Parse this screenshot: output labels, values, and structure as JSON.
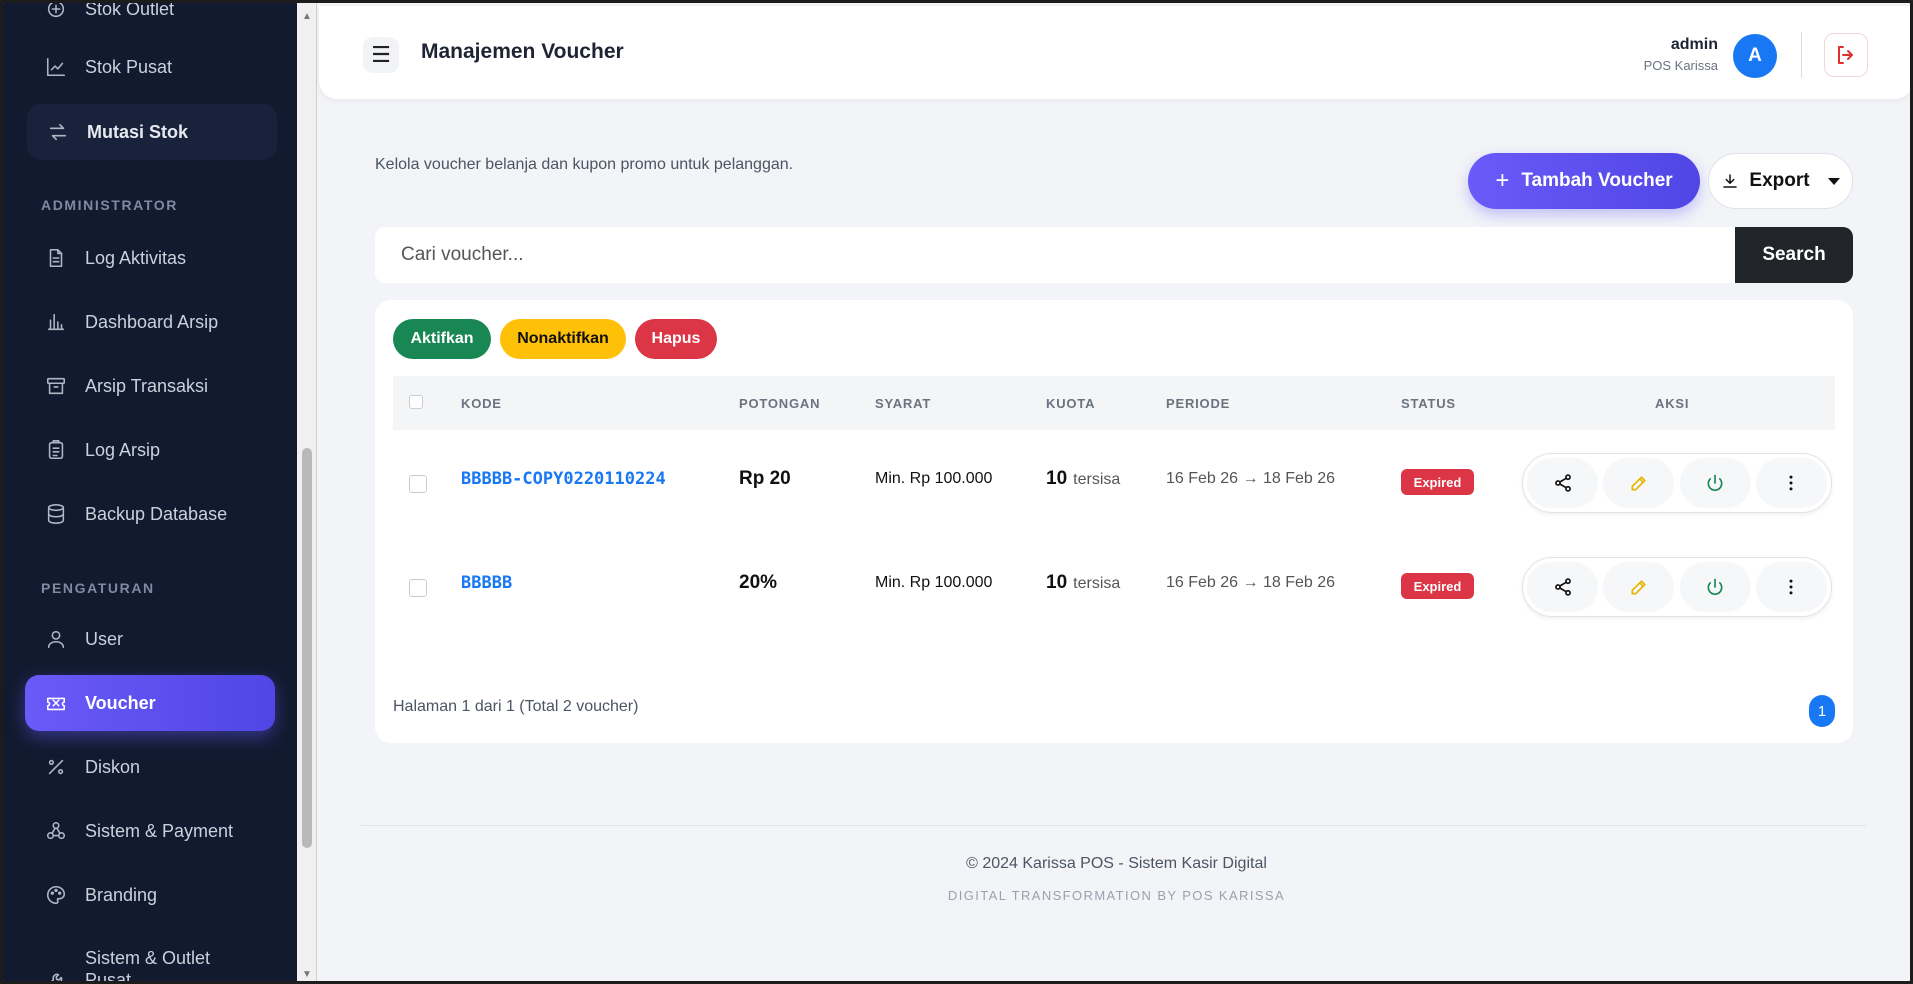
{
  "sidebar": {
    "items_top": [
      {
        "label": "Stok Outlet",
        "icon": "store-icon"
      },
      {
        "label": "Stok Pusat",
        "icon": "chart-icon"
      },
      {
        "label": "Mutasi Stok",
        "icon": "swap-icon"
      }
    ],
    "section_admin": "ADMINISTRATOR",
    "items_admin": [
      {
        "label": "Log Aktivitas",
        "icon": "file-text-icon"
      },
      {
        "label": "Dashboard Arsip",
        "icon": "bar-chart-icon"
      },
      {
        "label": "Arsip Transaksi",
        "icon": "archive-icon"
      },
      {
        "label": "Log Arsip",
        "icon": "clipboard-icon"
      },
      {
        "label": "Backup Database",
        "icon": "database-icon"
      }
    ],
    "section_settings": "PENGATURAN",
    "items_settings": [
      {
        "label": "User",
        "icon": "user-icon"
      },
      {
        "label": "Voucher",
        "icon": "ticket-icon"
      },
      {
        "label": "Diskon",
        "icon": "percent-icon"
      },
      {
        "label": "Sistem & Payment",
        "icon": "settings-icon"
      },
      {
        "label": "Branding",
        "icon": "palette-icon"
      },
      {
        "label": "Sistem & Outlet Pusat",
        "icon": "wrench-icon"
      }
    ]
  },
  "header": {
    "title": "Manajemen Voucher",
    "user_name": "admin",
    "user_role": "POS Karissa",
    "avatar_initial": "A"
  },
  "main": {
    "subtitle": "Kelola voucher belanja dan kupon promo untuk pelanggan.",
    "add_button": "Tambah Voucher",
    "export_button": "Export",
    "search_placeholder": "Cari voucher...",
    "search_button": "Search",
    "bulk_actions": {
      "activate": "Aktifkan",
      "deactivate": "Nonaktifkan",
      "delete": "Hapus"
    },
    "columns": [
      "KODE",
      "POTONGAN",
      "SYARAT",
      "KUOTA",
      "PERIODE",
      "STATUS",
      "AKSI"
    ],
    "rows": [
      {
        "code": "BBBBB-COPY0220110224",
        "discount": "Rp 20",
        "requirement": "Min. Rp 100.000",
        "quota": "10",
        "quota_suffix": "tersisa",
        "period": "16 Feb 26 → 18 Feb 26",
        "status": "Expired"
      },
      {
        "code": "BBBBB",
        "discount": "20%",
        "requirement": "Min. Rp 100.000",
        "quota": "10",
        "quota_suffix": "tersisa",
        "period": "16 Feb 26 → 18 Feb 26",
        "status": "Expired"
      }
    ],
    "pagination_info": "Halaman 1 dari 1 (Total 2 voucher)",
    "current_page": "1"
  },
  "footer": {
    "copyright": "© 2024 Karissa POS - Sistem Kasir Digital",
    "credit": "DIGITAL TRANSFORMATION BY POS KARISSA"
  },
  "colors": {
    "sidebar_bg": "#111a2e",
    "accent": "#5b50f0",
    "link_blue": "#1877f2",
    "danger": "#dc3545",
    "success": "#198754",
    "warning": "#ffc107"
  }
}
